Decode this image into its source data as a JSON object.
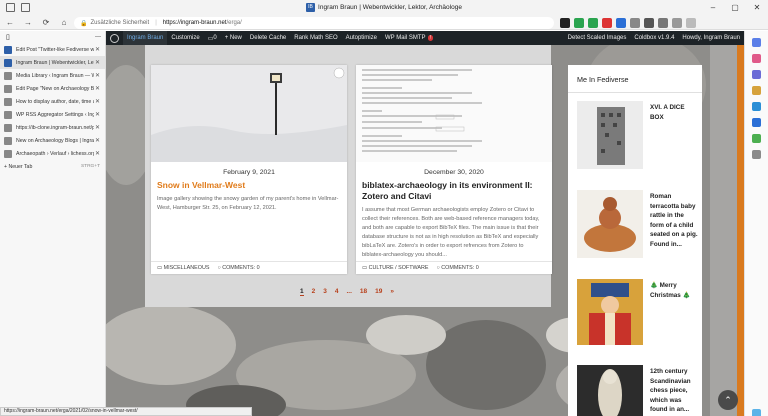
{
  "window": {
    "title": "Ingram Braun | Webentwickler, Lektor, Archäologe",
    "favicon": "IB"
  },
  "address": {
    "security": "Zusätzliche Sicherheit",
    "url_host": "https://ingram-braun.net",
    "url_path": "/erga/"
  },
  "tabs": {
    "items": [
      {
        "label": "Edit Post \"Twitter-like Fediverse widget\"",
        "color": "#2d5fa8"
      },
      {
        "label": "Ingram Braun | Webentwickler, Lektor, Arch",
        "color": "#2d5fa8",
        "active": true
      },
      {
        "label": "Media Library ‹ Ingram Braun — WordPress",
        "color": "#888888"
      },
      {
        "label": "Edit Page \"New on Archaeology Blogs\"",
        "color": "#888888"
      },
      {
        "label": "How to display author, date, time and",
        "color": "#888888"
      },
      {
        "label": "WP RSS Aggregator Settings ‹ Ingram",
        "color": "#888888"
      },
      {
        "label": "https://ib-clone.ingram-braun.net/p",
        "color": "#888888"
      },
      {
        "label": "New on Archaeology Blogs | Ingram",
        "color": "#888888"
      },
      {
        "label": "Archaeopath › Verlauf › lichess.org",
        "color": "#888888"
      }
    ],
    "new_tab": "Neuer Tab",
    "new_tab_kbd": "STRG+T"
  },
  "status_url": "https://ingram-braun.net/erga/2021/02/snow-in-vellmar-west/",
  "wpbar": {
    "site": "Ingram Braun",
    "customize": "Customize",
    "comments": "0",
    "new": "+ New",
    "delete_cache": "Delete Cache",
    "rank_math": "Rank Math SEO",
    "autoptimize": "Autoptimize",
    "wp_mail": "WP Mail SMTP",
    "wp_mail_badge": "!",
    "detect": "Detect Scaled Images",
    "coldbox": "Coldbox v1.9.4",
    "howdy": "Howdy, Ingram Braun"
  },
  "posts": [
    {
      "date": "February 9, 2021",
      "title": "Snow in Vellmar-West",
      "excerpt": "Image gallery showing the snowy garden of my parent's home in Vellmar-West, Hamburger Str. 25, on February 12, 2021.",
      "category": "MISCELLANEOUS",
      "comments": "COMMENTS: 0",
      "title_color": "#e07b1a"
    },
    {
      "date": "December 30, 2020",
      "title": "biblatex-archaeology in its environment II: Zotero and Citavi",
      "excerpt": "I assume that most German archaeologists employ Zotero or Citavi to collect their references. Both are web-based reference managers today, and both are capable to export BibTeX files. The main issue is that their database structure is not as in high resolution as BibTeX and especially bibLaTeX are. Zotero's in order to export refrences from Zotero to biblatex-archaeology you should...",
      "category": "CULTURE / SOFTWARE",
      "comments": "COMMENTS: 0",
      "title_color": "#222222"
    }
  ],
  "pagination": [
    "1",
    "2",
    "3",
    "4",
    "...",
    "18",
    "19",
    "»"
  ],
  "fediverse": {
    "heading": "Me In Fediverse",
    "items": [
      {
        "text": "XVI. A DICE BOX"
      },
      {
        "text": "Roman terracotta baby rattle in the form of a child seated on a pig. Found in..."
      },
      {
        "text": "🎄 Merry Christmas 🎄"
      },
      {
        "text": "12th century Scandinavian chess piece, which was found in an..."
      }
    ]
  },
  "icons": {
    "back": "back-arrow-icon",
    "forward": "forward-arrow-icon",
    "reload": "reload-icon",
    "home": "home-icon",
    "scroll_top": "scroll-to-top-icon"
  }
}
